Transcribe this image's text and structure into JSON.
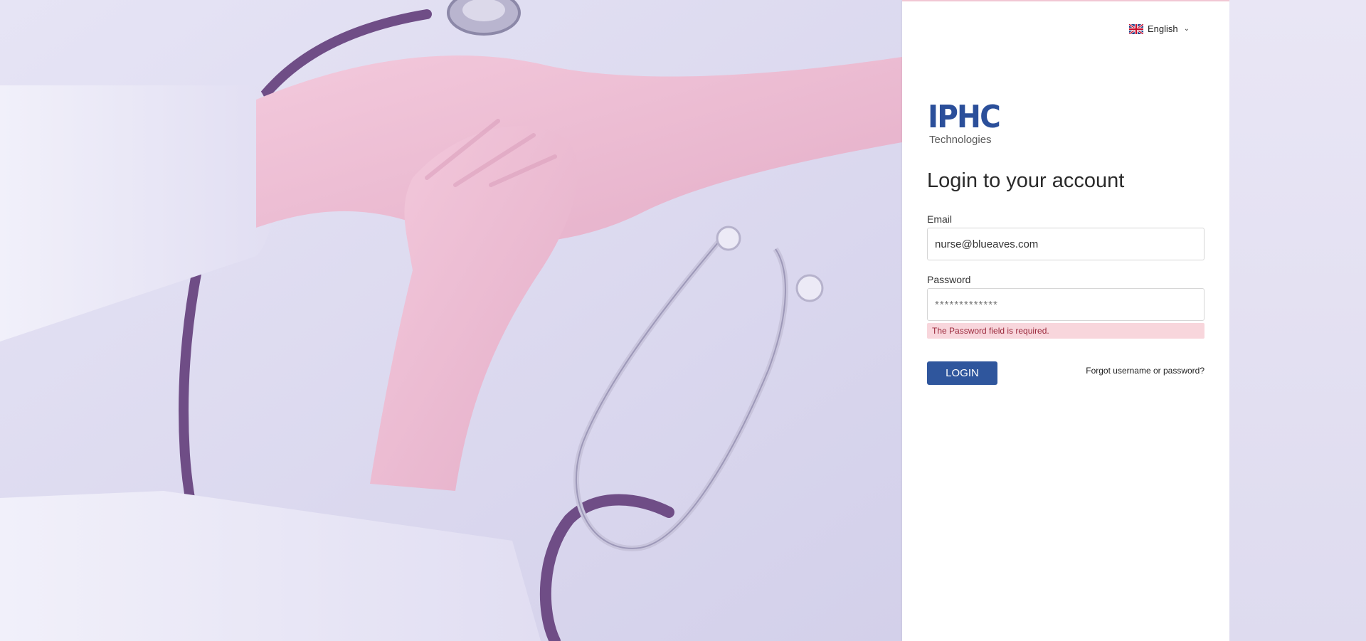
{
  "language": {
    "label": "English",
    "flag_icon": "uk-flag-icon"
  },
  "logo": {
    "main": "IPHC",
    "sub": "Technologies",
    "color": "#2b4f9a"
  },
  "form": {
    "title": "Login to your account",
    "email_label": "Email",
    "email_value": "nurse@blueaves.com",
    "password_label": "Password",
    "password_placeholder": "*************",
    "password_error": "The Password field is required.",
    "login_label": "LOGIN",
    "forgot_label": "Forgot username or password?"
  },
  "colors": {
    "accent": "#2f569d",
    "error_bg": "#f8d6dc",
    "error_text": "#9b2a3d"
  }
}
